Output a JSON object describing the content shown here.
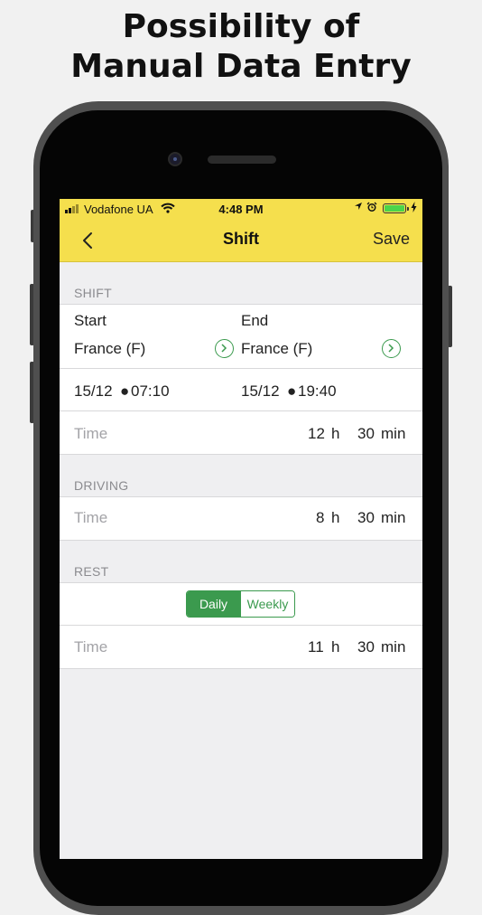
{
  "headline": {
    "line1": "Possibility of",
    "line2": "Manual Data Entry"
  },
  "status_bar": {
    "carrier": "Vodafone UA",
    "time": "4:48 PM"
  },
  "nav": {
    "title": "Shift",
    "save": "Save"
  },
  "shift": {
    "header": "SHIFT",
    "start_label": "Start",
    "end_label": "End",
    "start_country": "France (F)",
    "end_country": "France (F)",
    "start_date": "15/12",
    "start_time": "07:10",
    "end_date": "15/12",
    "end_time": "19:40",
    "time_label": "Time",
    "hours": "12",
    "h_unit": "h",
    "minutes": "30",
    "min_unit": "min"
  },
  "driving": {
    "header": "DRIVING",
    "time_label": "Time",
    "hours": "8",
    "h_unit": "h",
    "minutes": "30",
    "min_unit": "min"
  },
  "rest": {
    "header": "REST",
    "segment_daily": "Daily",
    "segment_weekly": "Weekly",
    "selected": "Daily",
    "time_label": "Time",
    "hours": "11",
    "h_unit": "h",
    "minutes": "30",
    "min_unit": "min"
  },
  "colors": {
    "accent_yellow": "#f5df4d",
    "accent_green": "#3b9a4e"
  }
}
